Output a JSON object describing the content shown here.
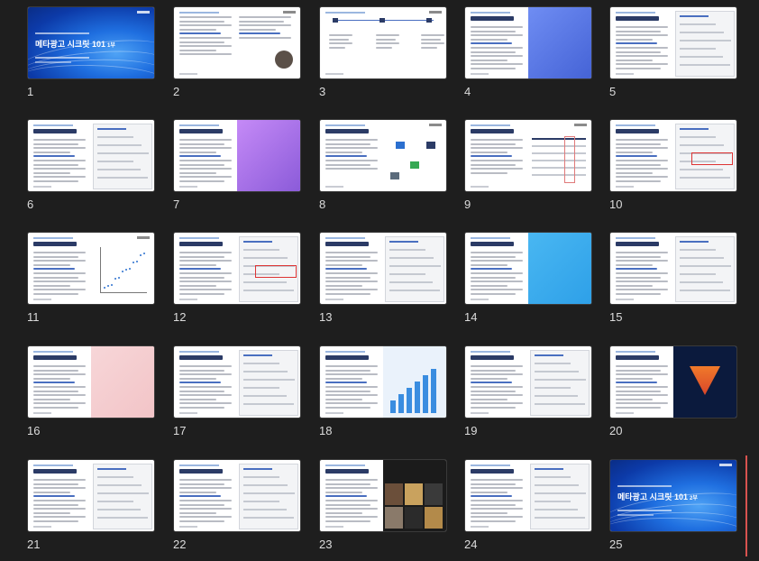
{
  "slides": [
    {
      "number": "1",
      "kind": "cover",
      "title": "메타광고 시크릿 101",
      "title_suffix": "1부"
    },
    {
      "number": "2",
      "kind": "text-photo"
    },
    {
      "number": "3",
      "kind": "flow"
    },
    {
      "number": "4",
      "kind": "text-illustration",
      "title": "픽셀(Pixel), 왜 중요한가요?"
    },
    {
      "number": "5",
      "kind": "text-screenshot",
      "title": "픽셀설치에 대해 알아보기"
    },
    {
      "number": "6",
      "kind": "text-screenshot",
      "title": "웹 설치 정보와 확인해보기"
    },
    {
      "number": "7",
      "kind": "text-illustration",
      "title": "개인정보보호와 광고 시장의 변화"
    },
    {
      "number": "8",
      "kind": "text-diagram",
      "title": "전환API는 무엇인가요?"
    },
    {
      "number": "9",
      "kind": "text-table",
      "title": "이벤트 매칭품질(EMQ)"
    },
    {
      "number": "10",
      "kind": "text-screenshot",
      "title": "이벤트 전환API 설정하기"
    },
    {
      "number": "11",
      "kind": "text-chart",
      "title": "EMQ와 광고 성과의 연관성"
    },
    {
      "number": "12",
      "kind": "text-screenshot",
      "title": "광고주와 학습이 이것이 중요한"
    },
    {
      "number": "13",
      "kind": "text-screenshot",
      "title": "계정 단위 전환 캠페인의 설정"
    },
    {
      "number": "14",
      "kind": "text-illustration",
      "title": "광고세트 지표는 통합이 대세"
    },
    {
      "number": "15",
      "kind": "text-screenshot",
      "title": "광고 자산 관련에 대해"
    },
    {
      "number": "16",
      "kind": "text-illustration",
      "title": "전환API: 사례와 전략"
    },
    {
      "number": "17",
      "kind": "text-screenshot",
      "title": "자동규칙을 통한 관리 자동화"
    },
    {
      "number": "18",
      "kind": "text-illustration",
      "title": "급격한 증가 시 유의사항"
    },
    {
      "number": "19",
      "kind": "text-screenshot",
      "title": "맞춤 타겟의 개념"
    },
    {
      "number": "20",
      "kind": "text-funnel",
      "title": "맞춤 타겟의 활용방향"
    },
    {
      "number": "21",
      "kind": "text-screenshot",
      "title": "맞춤 타겟 유의사항"
    },
    {
      "number": "22",
      "kind": "text-screenshot",
      "title": "유사 타겟의 개념"
    },
    {
      "number": "23",
      "kind": "text-photos",
      "title": "유사 타겟의 활용"
    },
    {
      "number": "24",
      "kind": "text-screenshot",
      "title": "유사 타겟의 개념"
    },
    {
      "number": "25",
      "kind": "cover",
      "title": "메타광고 시크릿 101",
      "title_suffix": "2부"
    }
  ],
  "colors": {
    "background": "#1e1e1e",
    "number_text": "#dcdcdc",
    "cover_blue": "#1f6fe0",
    "accent_blue": "#4a6fc0",
    "scroll_indicator": "#d9534f"
  }
}
